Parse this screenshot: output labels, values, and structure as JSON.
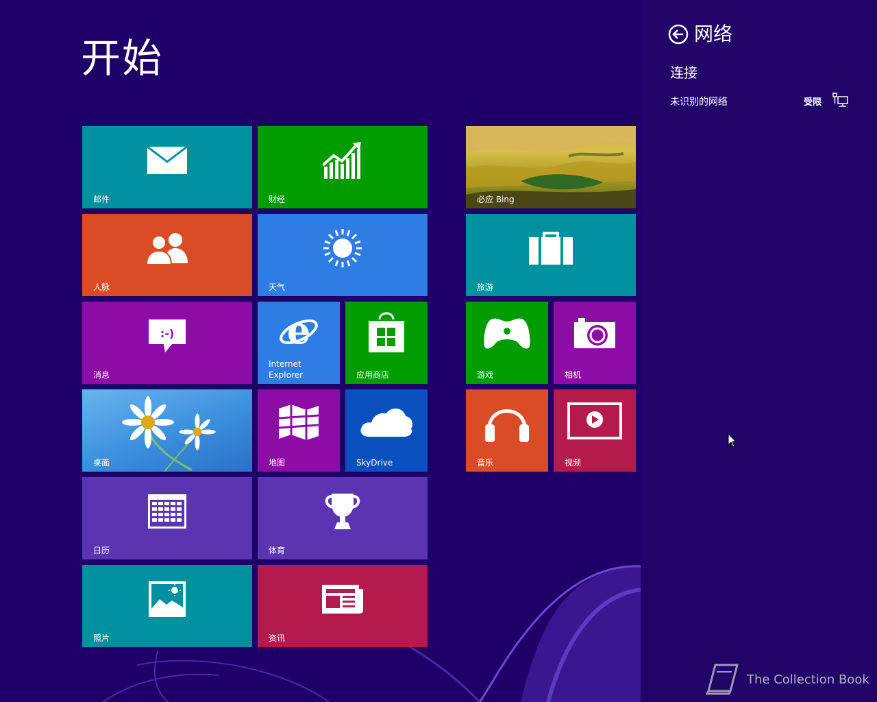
{
  "start": {
    "title": "开始"
  },
  "tiles": {
    "mail": "邮件",
    "finance": "财经",
    "bing": "必应 Bing",
    "people": "人脉",
    "weather": "天气",
    "travel": "旅游",
    "messaging": "消息",
    "ie_line1": "Internet",
    "ie_line2": "Explorer",
    "store": "应用商店",
    "games": "游戏",
    "camera": "相机",
    "desktop": "桌面",
    "maps": "地图",
    "skydrive": "SkyDrive",
    "music": "音乐",
    "video": "视频",
    "calendar": "日历",
    "sports": "体育",
    "photos": "照片",
    "news": "资讯"
  },
  "tile_colors": {
    "teal": "#00919f",
    "green": "#009c00",
    "orange": "#d94c27",
    "blue": "#2d7de4",
    "purple": "#8c0ca5",
    "dark_blue": "#0a4fc0",
    "violet": "#5b34b2",
    "crimson": "#b51b4a"
  },
  "charm": {
    "back_icon": "back-arrow-circle-icon",
    "title": "网络",
    "section": "连接",
    "network": {
      "name": "未识别的网络",
      "status": "受限",
      "icon": "wired-network-icon"
    }
  },
  "watermark": {
    "text": "The Collection Book",
    "icon": "book-icon"
  }
}
